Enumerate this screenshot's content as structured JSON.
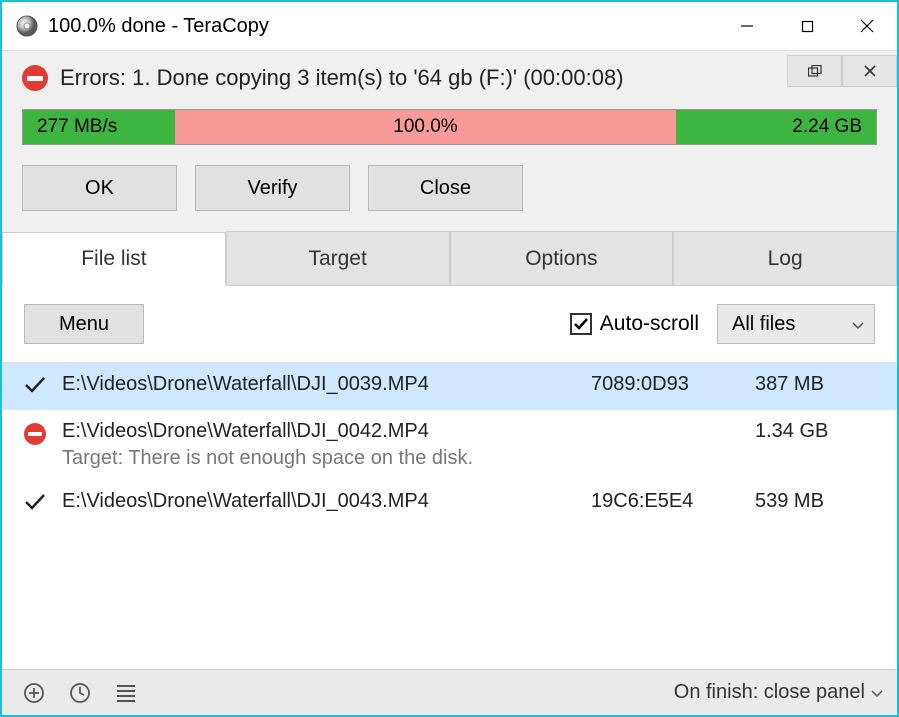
{
  "window": {
    "title": "100.0% done - TeraCopy"
  },
  "status": {
    "text": "Errors: 1. Done copying 3 item(s) to '64 gb (F:)' (00:00:08)"
  },
  "progress": {
    "speed": "277 MB/s",
    "percent": "100.0%",
    "total": "2.24 GB"
  },
  "actions": {
    "ok": "OK",
    "verify": "Verify",
    "close": "Close"
  },
  "tabs": {
    "filelist": "File list",
    "target": "Target",
    "options": "Options",
    "log": "Log"
  },
  "toolbar": {
    "menu": "Menu",
    "autoscroll": "Auto-scroll",
    "filter": "All files"
  },
  "files": [
    {
      "path": "E:\\Videos\\Drone\\Waterfall\\DJI_0039.MP4",
      "crc": "7089:0D93",
      "size": "387 MB",
      "status": "ok",
      "selected": true
    },
    {
      "path": "E:\\Videos\\Drone\\Waterfall\\DJI_0042.MP4",
      "crc": "",
      "size": "1.34 GB",
      "status": "error",
      "error": "Target: There is not enough space on the disk.",
      "selected": false
    },
    {
      "path": "E:\\Videos\\Drone\\Waterfall\\DJI_0043.MP4",
      "crc": "19C6:E5E4",
      "size": "539 MB",
      "status": "ok",
      "selected": false
    }
  ],
  "bottombar": {
    "onfinish": "On finish: close panel"
  }
}
